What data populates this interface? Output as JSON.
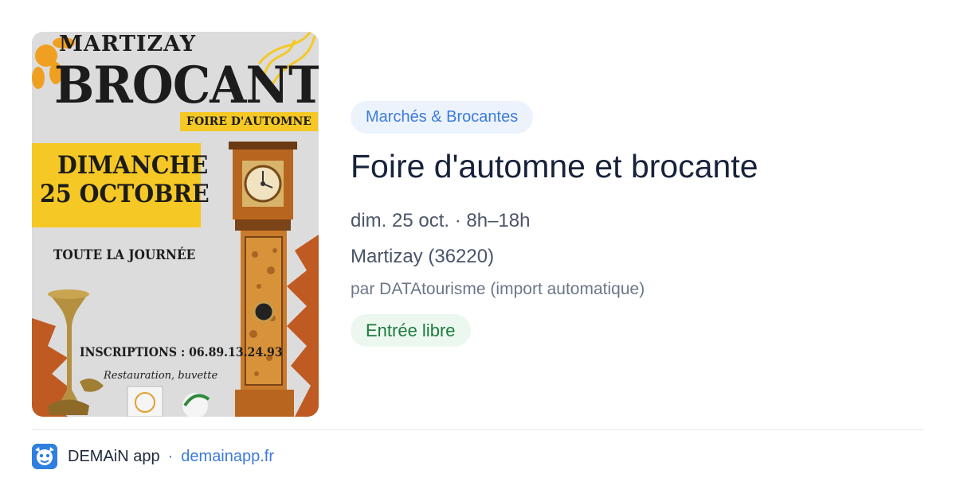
{
  "poster": {
    "town": "MARTIZAY",
    "headline": "BROCANTE",
    "subtitle": "FOIRE D'AUTOMNE",
    "day": "DIMANCHE",
    "date": "25 OCTOBRE",
    "schedule": "TOUTE LA JOURNÉE",
    "registration": "INSCRIPTIONS : 06.89.13.24.93",
    "catering": "Restauration, buvette"
  },
  "event": {
    "category": "Marchés & Brocantes",
    "title": "Foire d'automne et brocante",
    "datetime": "dim. 25 oct. · 8h–18h",
    "location": "Martizay (36220)",
    "author": "par DATAtourisme (import automatique)",
    "price": "Entrée libre"
  },
  "footer": {
    "app_name": "DEMAiN app",
    "separator": "·",
    "site": "demainapp.fr",
    "icon": "app-logo-icon"
  },
  "colors": {
    "accent": "#3c7bd9",
    "tag_bg": "#edf3fd",
    "free_bg": "#ecf8ef",
    "free_text": "#1d7a3e",
    "poster_yellow": "#f5c825",
    "poster_orange": "#c05a23"
  }
}
